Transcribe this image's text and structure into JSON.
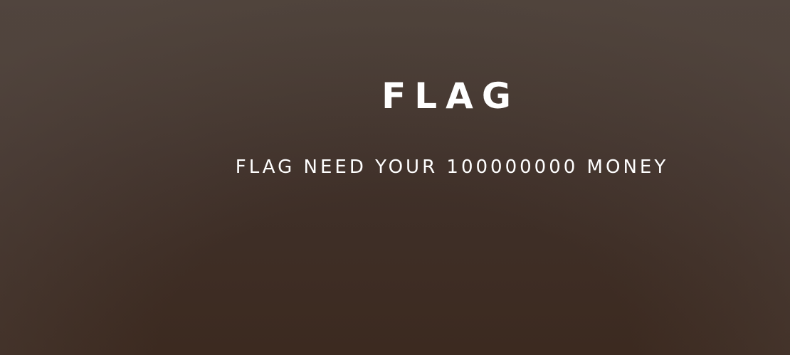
{
  "hero": {
    "title": "FLAG",
    "subtitle": "FLAG NEED YOUR 100000000 MONEY"
  },
  "colors": {
    "text": "#ffffff",
    "background_top": "#463a31",
    "background_bottom": "#3c2a20"
  }
}
